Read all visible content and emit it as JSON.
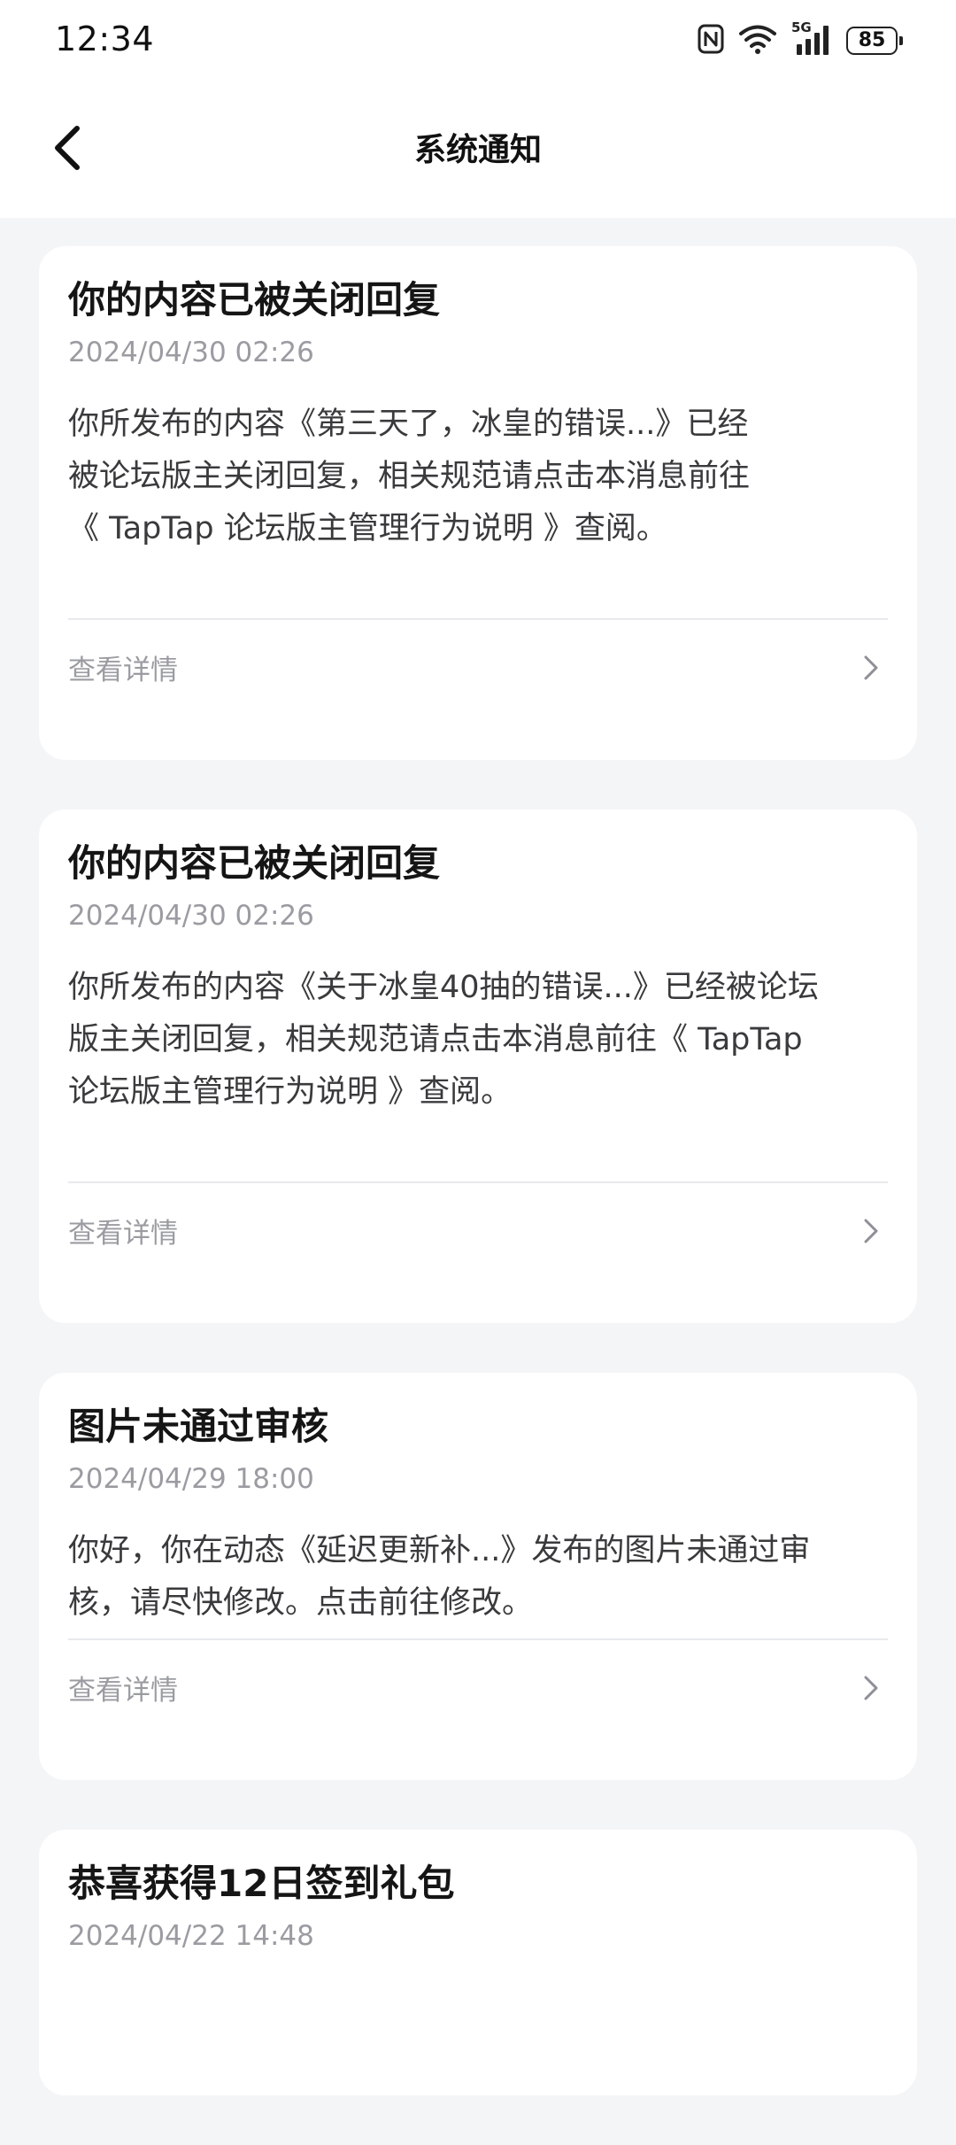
{
  "status_bar": {
    "time": "12:34",
    "network_label": "5G",
    "battery": "85"
  },
  "nav": {
    "title": "系统通知"
  },
  "notifications": [
    {
      "title": "你的内容已被关闭回复",
      "date": "2024/04/30 02:26",
      "body_lines": [
        "你所发布的内容《第三天了，冰皇的错误...》已经",
        "被论坛版主关闭回复，相关规范请点击本消息前往",
        "《 TapTap 论坛版主管理行为说明 》查阅。"
      ],
      "detail_label": "查看详情"
    },
    {
      "title": "你的内容已被关闭回复",
      "date": "2024/04/30 02:26",
      "body_lines": [
        "你所发布的内容《关于冰皇40抽的错误...》已经被论坛",
        "版主关闭回复，相关规范请点击本消息前往《 TapTap",
        "论坛版主管理行为说明 》查阅。"
      ],
      "detail_label": "查看详情"
    },
    {
      "title": "图片未通过审核",
      "date": "2024/04/29 18:00",
      "body_lines": [
        "你好，你在动态《延迟更新补...》发布的图片未通过审",
        "核，请尽快修改。点击前往修改。"
      ],
      "detail_label": "查看详情"
    },
    {
      "title": "恭喜获得12日签到礼包",
      "date": "2024/04/22 14:48"
    }
  ]
}
